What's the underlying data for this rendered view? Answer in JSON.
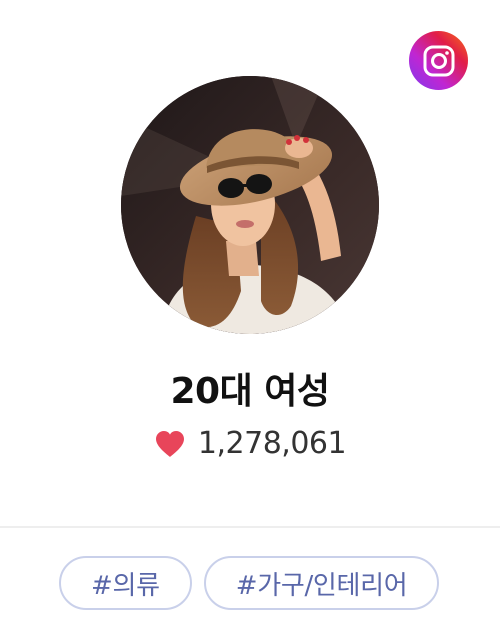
{
  "profile": {
    "name": "20대 여성",
    "likes": "1,278,061",
    "avatar_icon": "woman-in-sun-hat-photo"
  },
  "social": {
    "icon": "instagram-icon"
  },
  "tags": [
    {
      "label": "#의류"
    },
    {
      "label": "#가구/인테리어"
    }
  ],
  "colors": {
    "heart": "#e8455a",
    "tag_text": "#5967a9",
    "tag_border": "#c9d0ea",
    "instagram_gradient": [
      "#7c3aed",
      "#c026d3",
      "#e11d48",
      "#f97316"
    ]
  }
}
